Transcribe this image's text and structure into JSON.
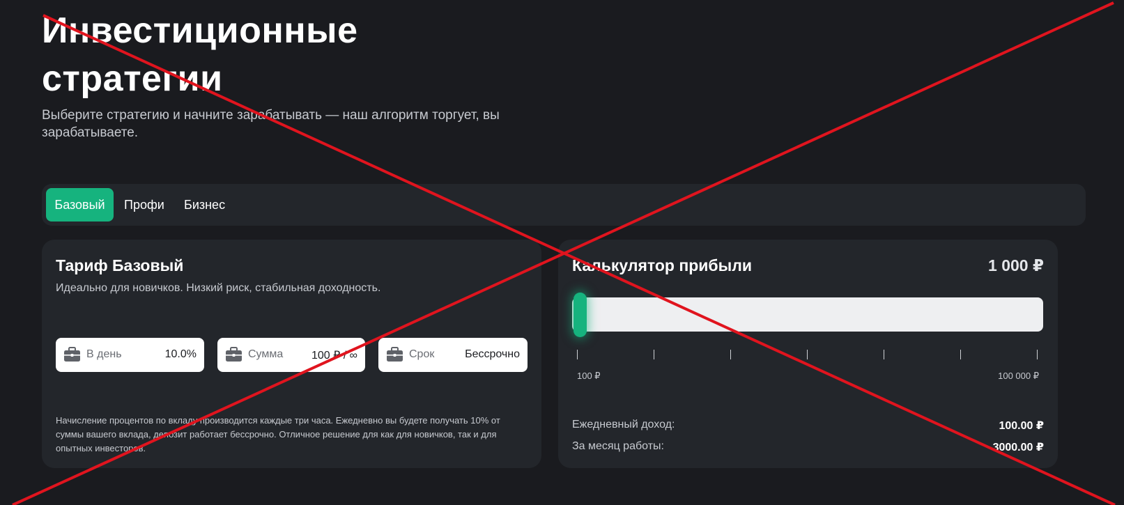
{
  "header": {
    "title": "Инвестиционные стратегии",
    "subtitle": "Выберите стратегию и начните зарабатывать — наш алгоритм торгует, вы зарабатываете."
  },
  "tabs": [
    {
      "label": "Базовый",
      "active": true
    },
    {
      "label": "Профи",
      "active": false
    },
    {
      "label": "Бизнес",
      "active": false
    }
  ],
  "tariff": {
    "title": "Тариф Базовый",
    "description": "Идеально для новичков. Низкий риск, стабильная доходность.",
    "stats": [
      {
        "icon": "briefcase-icon",
        "label": "В день",
        "value": "10.0%"
      },
      {
        "icon": "briefcase-icon",
        "label": "Сумма",
        "value": "100 ₽ / ∞"
      },
      {
        "icon": "briefcase-icon",
        "label": "Срок",
        "value": "Бессрочно"
      }
    ],
    "note": "Начисление процентов по вкладу производится каждые три часа. Ежедневно вы будете получать 10% от суммы вашего вклада, депозит работает бессрочно. Отличное решение для как для новичков, так и для опытных инвесторов."
  },
  "calculator": {
    "title": "Калькулятор прибыли",
    "amount": "1 000 ₽",
    "slider": {
      "min_label": "100 ₽",
      "max_label": "100 000 ₽",
      "fill_fraction": 0.01
    },
    "daily_label": "Ежедневный доход:",
    "daily_value": "100.00 ₽",
    "monthly_label": "За месяц работы:",
    "monthly_value": "3000.00 ₽"
  },
  "colors": {
    "background": "#1a1b1f",
    "card": "#23262b",
    "accent": "#16b37e",
    "overlay_cross": "#e0141e"
  }
}
